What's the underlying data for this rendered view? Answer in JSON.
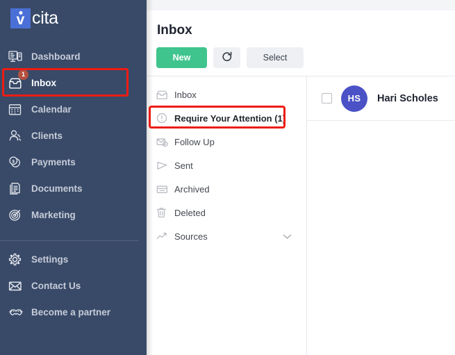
{
  "brand": {
    "mark_letter": "v",
    "name": "cita"
  },
  "sidebar": {
    "primary_items": [
      {
        "label": "Dashboard",
        "icon": "dashboard-icon",
        "badge": ""
      },
      {
        "label": "Inbox",
        "icon": "inbox-icon",
        "badge": "1"
      },
      {
        "label": "Calendar",
        "icon": "calendar-icon",
        "badge": ""
      },
      {
        "label": "Clients",
        "icon": "clients-icon",
        "badge": ""
      },
      {
        "label": "Payments",
        "icon": "payments-icon",
        "badge": ""
      },
      {
        "label": "Documents",
        "icon": "documents-icon",
        "badge": ""
      },
      {
        "label": "Marketing",
        "icon": "marketing-icon",
        "badge": ""
      }
    ],
    "secondary_items": [
      {
        "label": "Settings",
        "icon": "gear-icon"
      },
      {
        "label": "Contact Us",
        "icon": "envelope-icon"
      },
      {
        "label": "Become a partner",
        "icon": "handshake-icon"
      }
    ],
    "background_color": "#394a68"
  },
  "header": {
    "title": "Inbox",
    "new_label": "New",
    "refresh_icon": "refresh-icon",
    "select_label": "Select"
  },
  "folders": {
    "items": [
      {
        "label": "Inbox",
        "icon": "inbox-tray-icon",
        "active": false
      },
      {
        "label": "Require Your Attention (1)",
        "icon": "exclamation-circle-icon",
        "active": true
      },
      {
        "label": "Follow Up",
        "icon": "follow-up-icon",
        "active": false
      },
      {
        "label": "Sent",
        "icon": "send-icon",
        "active": false
      },
      {
        "label": "Archived",
        "icon": "archive-icon",
        "active": false
      },
      {
        "label": "Deleted",
        "icon": "trash-icon",
        "active": false
      },
      {
        "label": "Sources",
        "icon": "trend-line-icon",
        "active": false,
        "expandable": true
      }
    ]
  },
  "conversations": {
    "rows": [
      {
        "initials": "HS",
        "name": "Hari Scholes",
        "avatar_color": "#4a52c6",
        "checked": false
      }
    ]
  },
  "annotations": {
    "highlight_color": "#ee1c14",
    "inbox_highlight": "Inbox",
    "attention_highlight": "Require Your Attention (1)"
  },
  "colors": {
    "accent_green": "#3fc48d",
    "sidebar_navy": "#394a68",
    "badge_red": "#b4503f",
    "avatar_blue": "#4a52c6"
  }
}
